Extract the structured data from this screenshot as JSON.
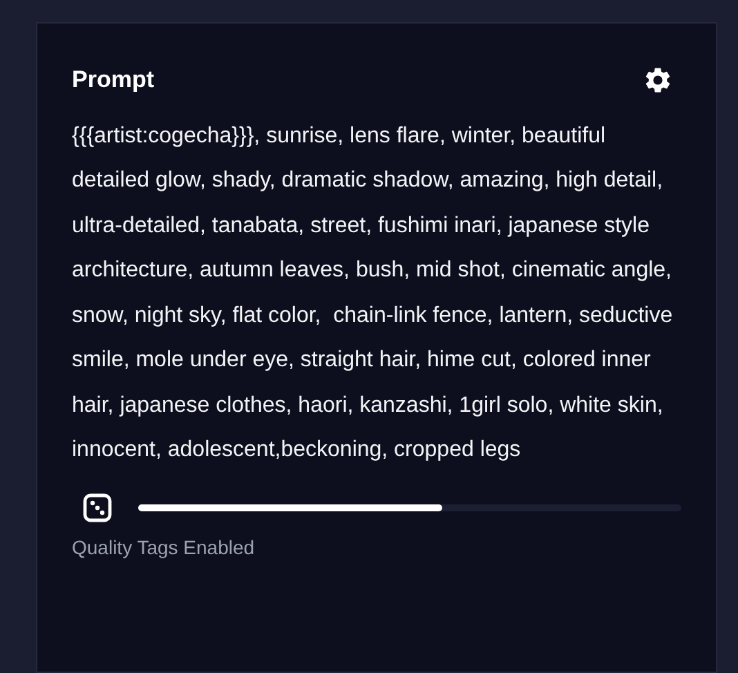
{
  "panel": {
    "title": "Prompt",
    "prompt": "{{{artist:cogecha}}}, sunrise, lens flare, winter, beautiful detailed glow, shady, dramatic shadow, amazing, high detail, ultra-detailed, tanabata, street, fushimi inari, japanese style architecture, autumn leaves, bush, mid shot, cinematic angle, snow, night sky, flat color,  chain-link fence, lantern, seductive smile, mole under eye, straight hair, hime cut, colored inner hair, japanese clothes, haori, kanzashi, 1girl solo, white skin, innocent, adolescent,beckoning, cropped legs",
    "progress": {
      "level": 0.56
    },
    "status": "Quality Tags Enabled"
  }
}
